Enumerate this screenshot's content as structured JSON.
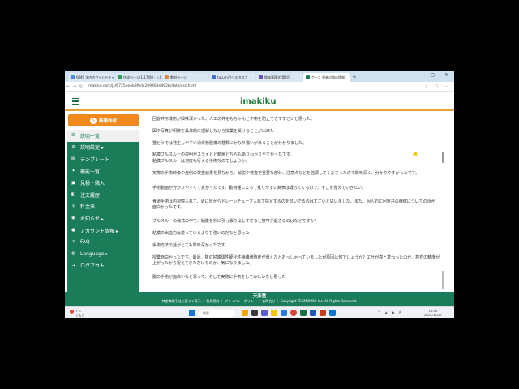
{
  "browser": {
    "tabs": [
      "WMS 学内ホワイトドキャンパス",
      "作成ページ(1.174h) - n.haunan",
      "教材ページ",
      "takumiからのタスク",
      "臨床薬理学 第4回",
      "ケース 患者の臨床情報"
    ],
    "new_tab": "+",
    "window_controls": "– ▢ ✕",
    "url": "imakiku.com/js/6725eeeb8f6dc209463e462b/data/csc.html",
    "address_tools": "☆ ▢ ⋯"
  },
  "header": {
    "logo": "imakiku"
  },
  "sidebar": {
    "new_post": "新規作成",
    "items": [
      {
        "label": "説明一覧",
        "icon": "list-icon",
        "glyph": "☰",
        "active": true
      },
      {
        "label": "説明設定 ▸",
        "icon": "gear-icon",
        "glyph": "⚙"
      },
      {
        "label": "テンプレート",
        "icon": "template-icon",
        "glyph": "▤"
      },
      {
        "label": "機能一覧",
        "icon": "function-icon",
        "glyph": "✦"
      },
      {
        "label": "見積・購入",
        "icon": "cart-icon",
        "glyph": "▣"
      },
      {
        "label": "注文履歴",
        "icon": "history-icon",
        "glyph": "◧"
      },
      {
        "label": "料金表",
        "icon": "price-icon",
        "glyph": "$"
      },
      {
        "label": "お知らせ ▸",
        "icon": "bell-icon",
        "glyph": "◉"
      },
      {
        "label": "アカウント情報 ▸",
        "icon": "user-icon",
        "glyph": "●"
      },
      {
        "label": "FAQ",
        "icon": "question-icon",
        "glyph": "?"
      },
      {
        "label": "Language ▸",
        "icon": "globe-icon",
        "glyph": "◍"
      },
      {
        "label": "ログアウト",
        "icon": "logout-icon",
        "glyph": "⇥"
      }
    ]
  },
  "main": {
    "lines": [
      "回盲弁形成術が興味深かった。人工の弁をもちゃんと下痢を防止できてすごいと思った。",
      "図や写真が明瞭で具体的に理解しながら授業を受けることが出来た",
      "猫とうでは発生しやすい消化管腫瘍の種類にかなり違いがあることが分かりました。",
      "粘膜ブルスルーの説明がスライドと動画どちらもありわかりやすかったです。",
      "粘膜ブルスルーは何度も行える手術なのでしょうか。",
      "実際の手術映像や症例の検査結果を見ながら、解説や検査で重要な部分、注意点などを強調してくださったので興味深く、分かりやすかったです。",
      "手術動画が分かりやすくて良かったです。動物種によって罹りやすい病気は違ってくるので、そこを覚えていきたい。",
      "食道手術は内視鏡入れて、更に胃からドレーンチューブ入れて採写するのを怠いでるのはすごいと思いました。また、個人的に回盲弁の腫瘍についての話が面白かったです。",
      "ブルスルーの病式の中で、粘膜を外に引っ張り出しすぎると狭窄が起きるのはなぜですか？",
      "粘膜の出血力は変っているよりも強いのだなと思った",
      "手術方法の話がとても興味深かったです。",
      "授業面白かったです。最近、猫の好酸球性硬化性線維増殖症が増えたとおっしゃっていましたが原因は何でしょうか？エサが高と変わったのか、検査の精度が上がったから捉えてきただけなのか、気になりました。",
      "腸の手術が面白いなと思って、そして実際に手術をしてみたいなと思った"
    ]
  },
  "footer": {
    "brand": "天店重",
    "links": "特定商取引法に基づく表示 ｜ 利用規約 ｜ プライバシーポリシー ｜ お問合せ ｜ Copyright TENMONDO Inc. All Rights Reserved."
  },
  "taskbar": {
    "weather_temp": "7°C",
    "weather_desc": "くもり",
    "search_placeholder": "検索",
    "tray": "^ ▲ ◉ A",
    "time": "15:50",
    "date": "2024/11/27"
  },
  "colors": {
    "brand_green": "#1b7c5a",
    "accent_orange": "#f08a1d",
    "header_rule": "#e6a532"
  }
}
